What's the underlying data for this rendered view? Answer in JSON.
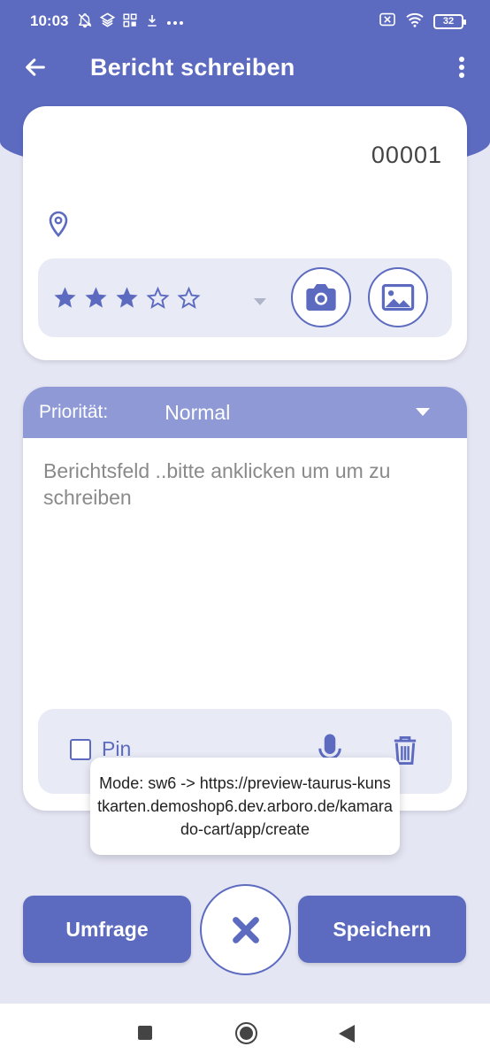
{
  "colors": {
    "primary": "#5c6bc0",
    "priority_bar": "#8e99d6",
    "panel": "#e8eaf6",
    "background": "#e5e6f4"
  },
  "status_bar": {
    "time": "10:03",
    "battery": "32",
    "icons": [
      "notifications-off-icon",
      "layers-icon",
      "grid-icon",
      "download-icon",
      "more-dots-icon",
      "sim-off-icon",
      "wifi-icon",
      "battery-icon"
    ]
  },
  "app_bar": {
    "title": "Bericht schreiben"
  },
  "report": {
    "number": "00001",
    "rating": 3,
    "rating_max": 5
  },
  "priority": {
    "label": "Priorität:",
    "value": "Normal"
  },
  "report_field": {
    "placeholder": "Berichtsfeld ..bitte anklicken um um zu schreiben"
  },
  "tools": {
    "pin_label": "Pin",
    "pin_checked": false
  },
  "toast": {
    "message": "Mode: sw6 -> https://preview-taurus-kunstkarten.demoshop6.dev.arboro.de/kamarado-cart/app/create"
  },
  "buttons": {
    "survey": "Umfrage",
    "save": "Speichern"
  }
}
